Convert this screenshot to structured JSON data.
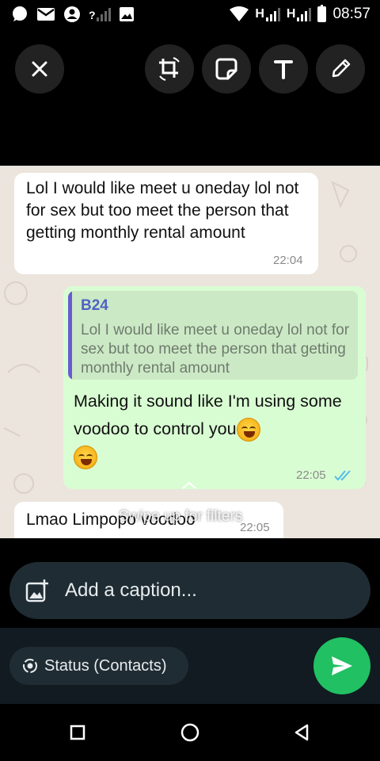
{
  "status_bar": {
    "time": "08:57",
    "network_1": "H",
    "network_2": "H",
    "unknown_sim": "?",
    "icons": [
      "whatsapp-icon",
      "gmail-icon",
      "account-icon",
      "no-signal-icon",
      "gallery-icon",
      "wifi-icon",
      "signal-icon",
      "battery-icon"
    ]
  },
  "toolbar": {
    "icons": [
      "close-icon",
      "crop-rotate-icon",
      "sticker-icon",
      "text-icon",
      "pencil-icon"
    ]
  },
  "chat": {
    "msg1": {
      "text": "Lol I would like meet u oneday lol not for sex but too meet the person that getting monthly rental amount",
      "time": "22:04"
    },
    "msg2": {
      "quote_name": "B24",
      "quote_text": "Lol I would like meet u oneday lol not for sex but too meet the person that getting monthly rental amount",
      "text": "Making it sound like I'm using some voodoo to control you",
      "emoji": "rolling-on-floor-laughing-emoji",
      "time": "22:05",
      "read_receipt": "double-check-icon"
    },
    "msg3": {
      "text": "Lmao Limpopo voodoo",
      "time": "22:05"
    },
    "swipe_hint": "Swipe up for filters"
  },
  "caption": {
    "placeholder": "Add a caption..."
  },
  "bottom": {
    "status_label": "Status (Contacts)",
    "send_icon": "send-icon"
  },
  "nav": {
    "icons": [
      "recents-icon",
      "home-icon",
      "back-icon"
    ]
  },
  "colors": {
    "send_green": "#21C063",
    "out_bubble": "#D9FDD3",
    "chat_bg": "#ECE5DD",
    "read_blue": "#53BDEB"
  }
}
